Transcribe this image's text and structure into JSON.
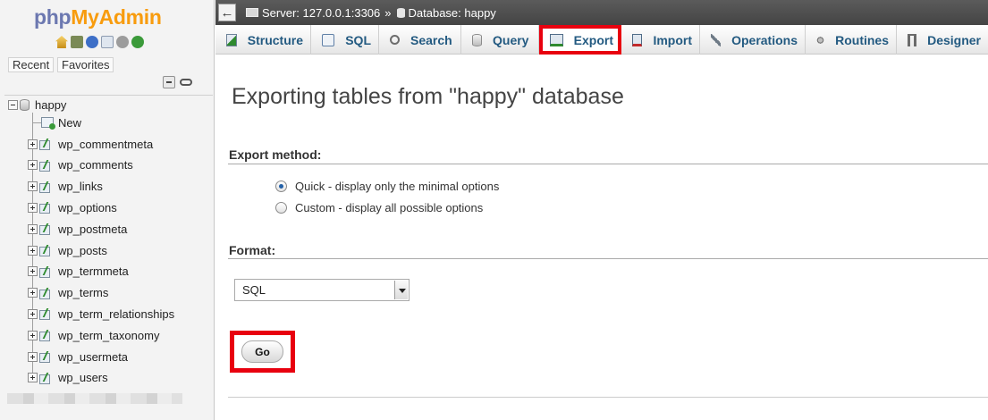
{
  "nav": {
    "logo_php": "php",
    "logo_myadmin": "MyAdmin",
    "icons": [
      "home-icon",
      "exit-icon",
      "help-icon",
      "docs-icon",
      "settings-icon",
      "reload-icon"
    ],
    "recent_label": "Recent",
    "favorites_label": "Favorites",
    "database": "happy",
    "new_label": "New",
    "tables": [
      "wp_commentmeta",
      "wp_comments",
      "wp_links",
      "wp_options",
      "wp_postmeta",
      "wp_posts",
      "wp_termmeta",
      "wp_terms",
      "wp_term_relationships",
      "wp_term_taxonomy",
      "wp_usermeta",
      "wp_users"
    ]
  },
  "breadcrumb": {
    "back": "←",
    "server": "Server: 127.0.0.1:3306",
    "separator": "»",
    "database": "Database: happy"
  },
  "menu": {
    "tabs": [
      "Structure",
      "SQL",
      "Search",
      "Query",
      "Export",
      "Import",
      "Operations",
      "Routines",
      "Designer"
    ],
    "active": "Export"
  },
  "main": {
    "title": "Exporting tables from \"happy\" database",
    "export_method_label": "Export method:",
    "method_quick": "Quick - display only the minimal options",
    "method_custom": "Custom - display all possible options",
    "selected_method": "Quick",
    "format_label": "Format:",
    "format_value": "SQL",
    "go_label": "Go"
  },
  "colors": {
    "highlight": "#e8000f",
    "link": "#235a81",
    "logo_php": "#6c78b0",
    "logo_myadmin": "#f89c0e"
  }
}
